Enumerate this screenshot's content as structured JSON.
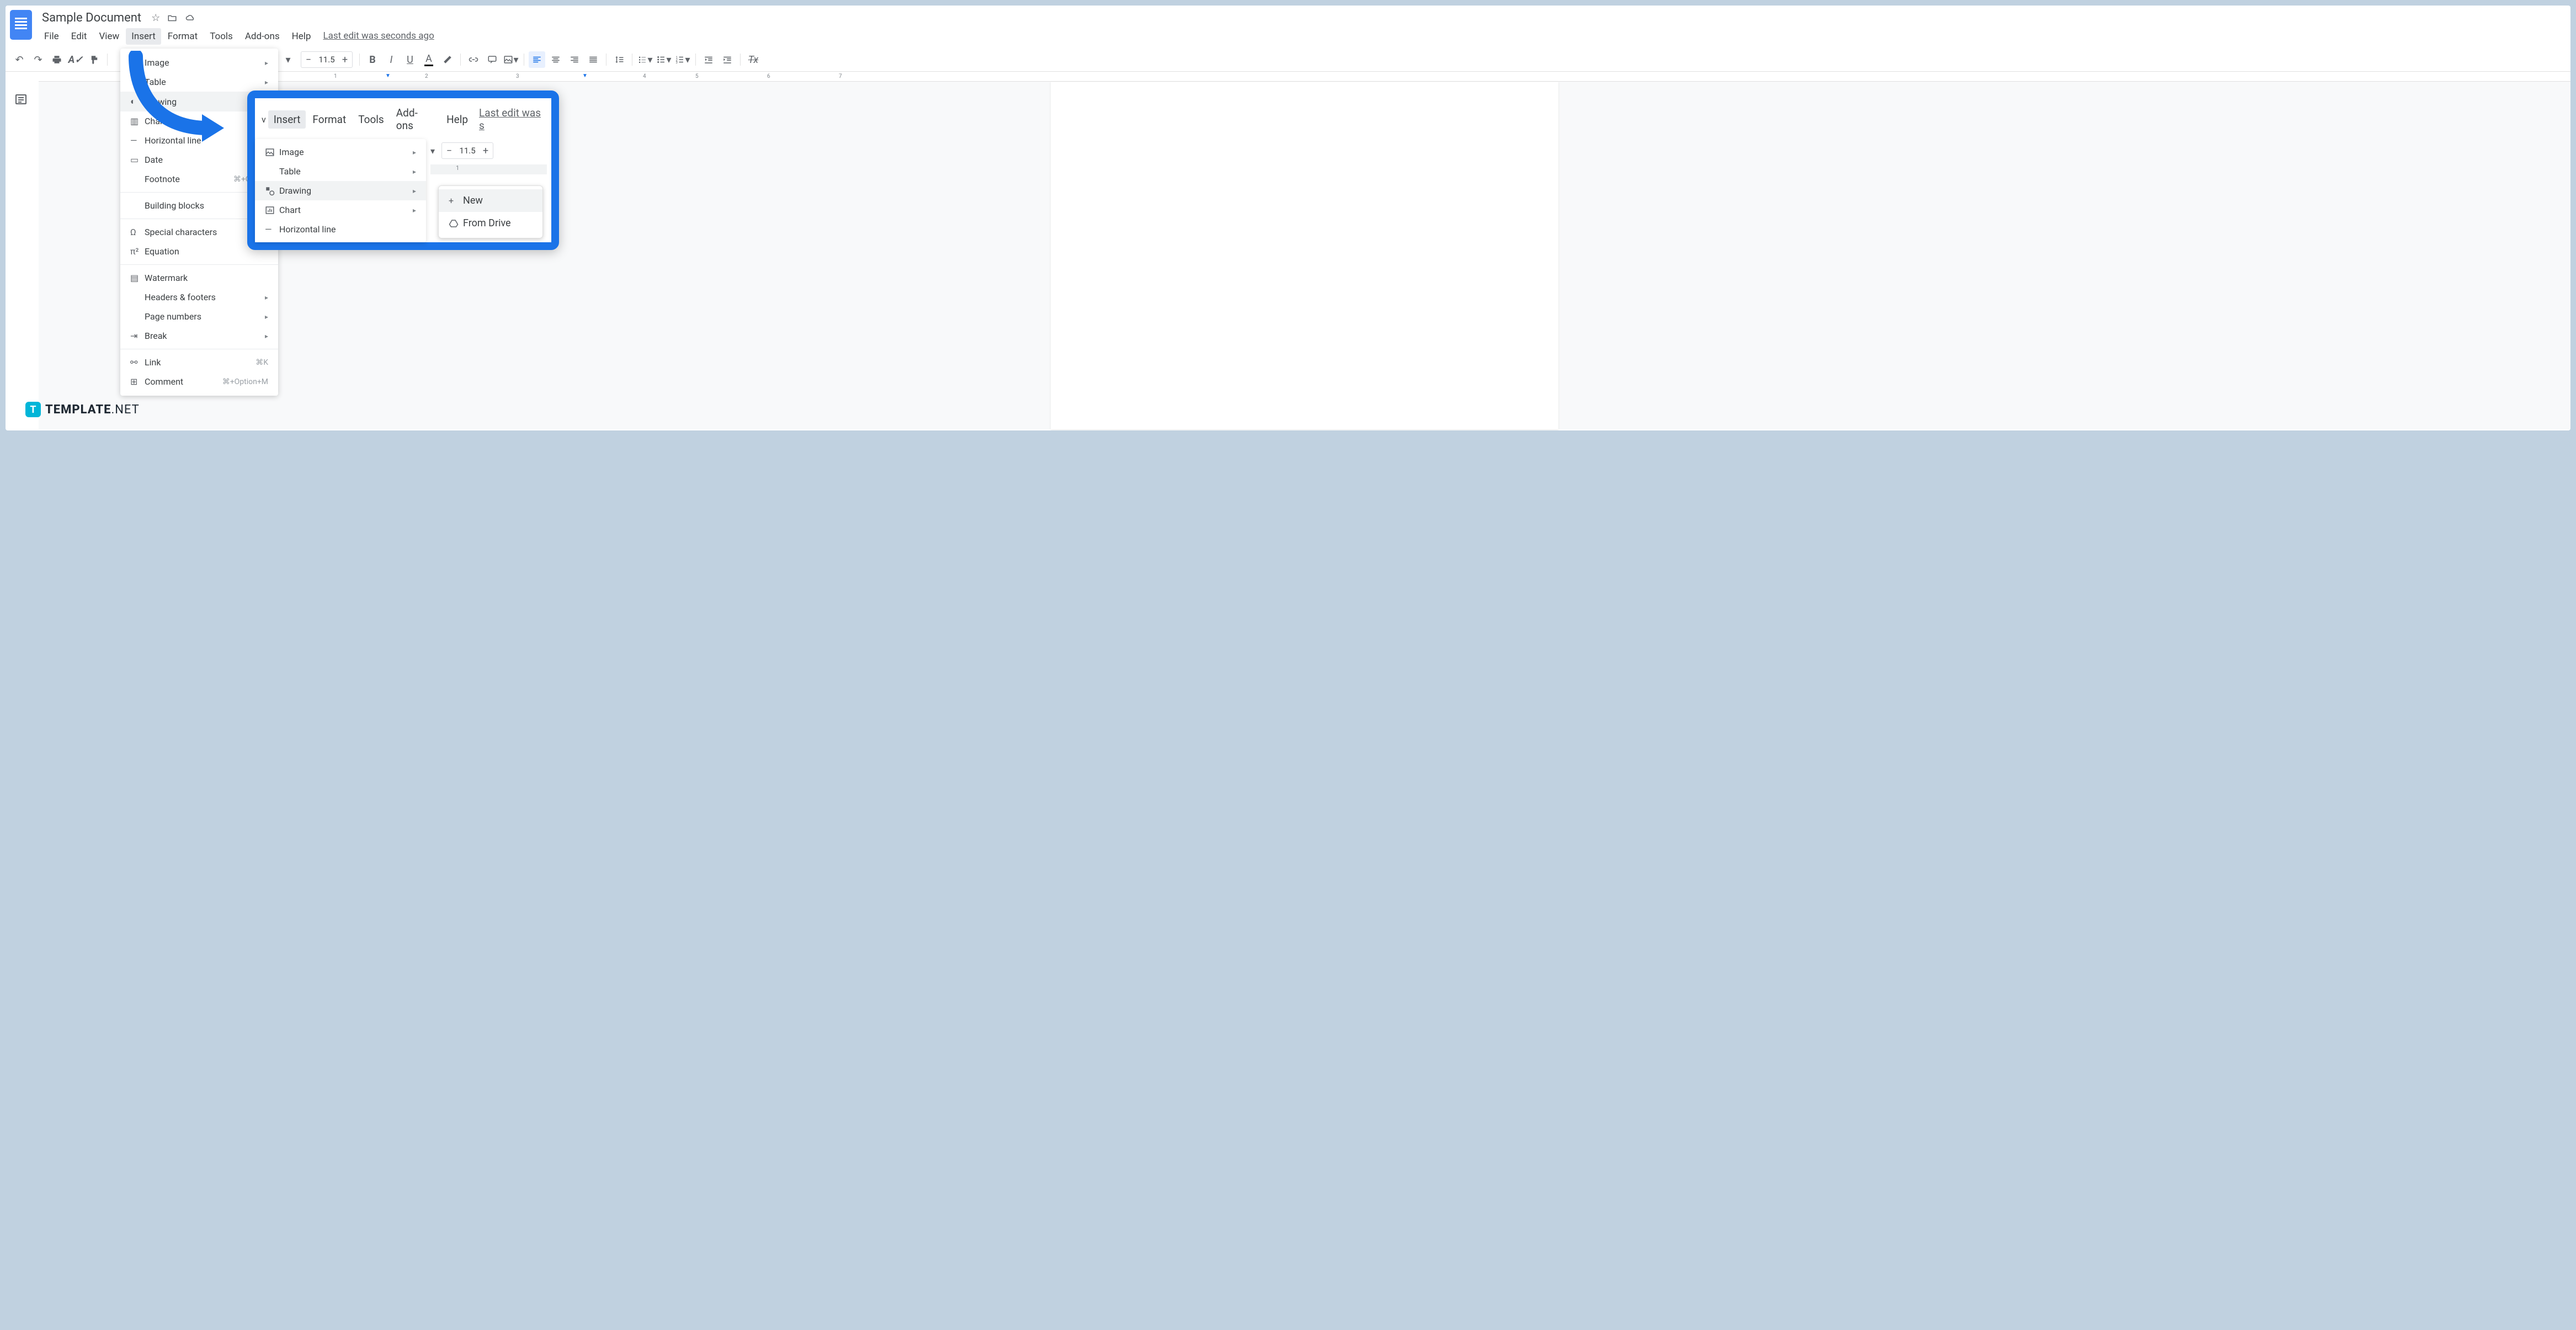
{
  "header": {
    "doc_title": "Sample Document",
    "last_edit": "Last edit was seconds ago"
  },
  "menubar": [
    "File",
    "Edit",
    "View",
    "Insert",
    "Format",
    "Tools",
    "Add-ons",
    "Help"
  ],
  "toolbar": {
    "font_size": "11.5"
  },
  "insert_menu": {
    "image": "Image",
    "table": "Table",
    "drawing": "Drawing",
    "chart": "Chart",
    "horizontal_line": "Horizontal line",
    "date": "Date",
    "footnote": "Footnote",
    "footnote_shortcut": "⌘+Option",
    "building_blocks": "Building blocks",
    "special_chars": "Special characters",
    "equation": "Equation",
    "watermark": "Watermark",
    "headers_footers": "Headers & footers",
    "page_numbers": "Page numbers",
    "break": "Break",
    "link": "Link",
    "link_shortcut": "⌘K",
    "comment": "Comment",
    "comment_shortcut": "⌘+Option+M"
  },
  "inset": {
    "menubar_tail": [
      "Insert",
      "Format",
      "Tools",
      "Add-ons",
      "Help"
    ],
    "last_edit": "Last edit was s",
    "font_size": "11.5",
    "items": {
      "image": "Image",
      "table": "Table",
      "drawing": "Drawing",
      "chart": "Chart",
      "horizontal_line": "Horizontal line"
    },
    "submenu": {
      "new": "New",
      "from_drive": "From Drive"
    }
  },
  "ruler_marks": [
    "1",
    "2",
    "3",
    "4",
    "5",
    "6",
    "7"
  ],
  "watermark": {
    "brand_bold": "TEMPLATE",
    "brand_light": ".NET"
  }
}
